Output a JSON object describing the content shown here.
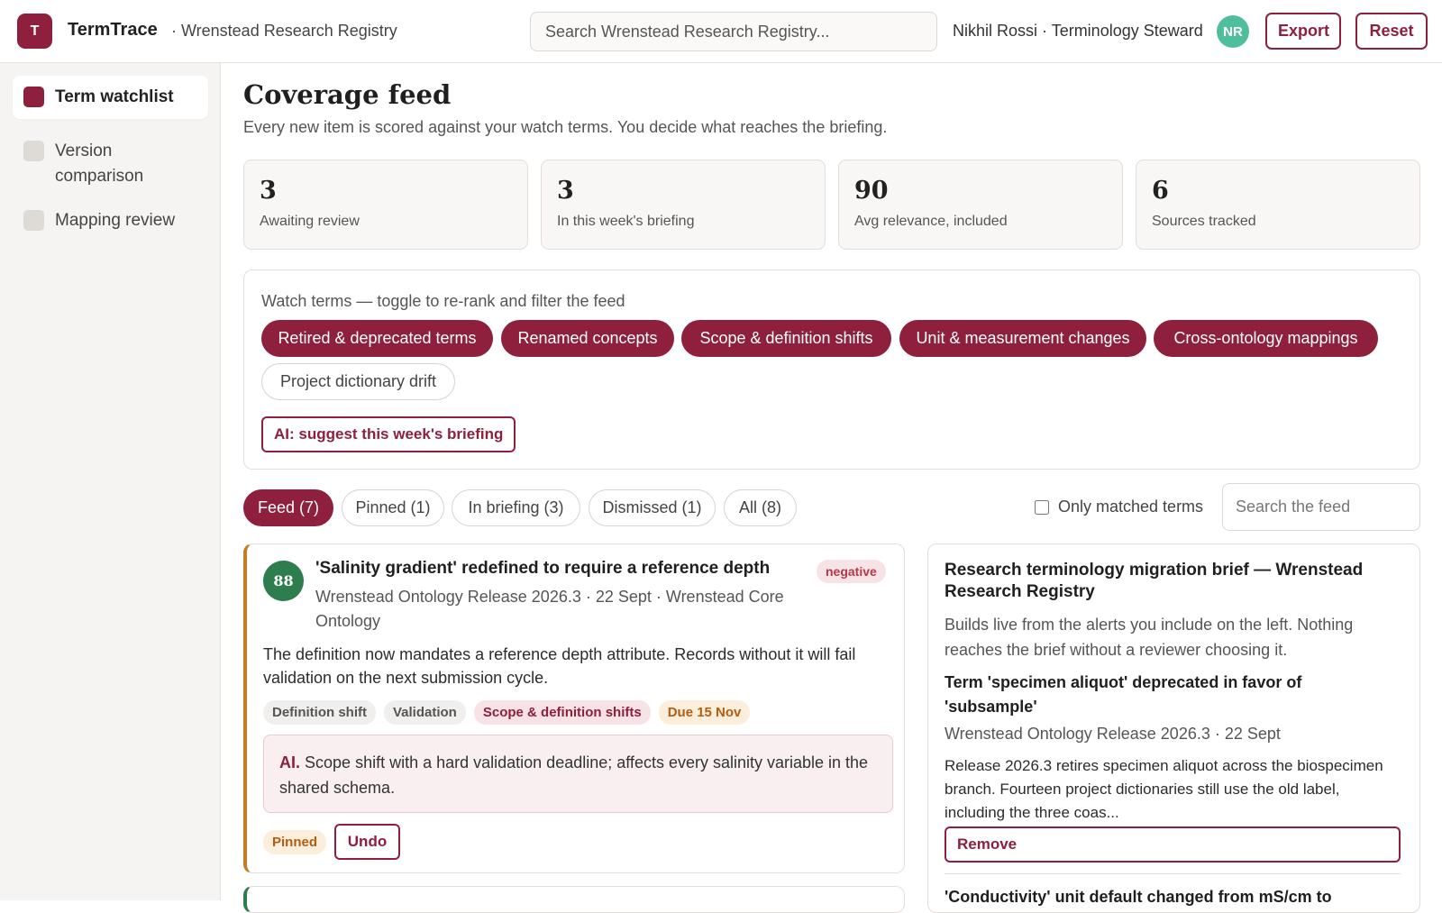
{
  "header": {
    "logo_letter": "T",
    "app_name": "TermTrace",
    "app_sub": "· Wrenstead Research Registry",
    "search_placeholder": "Search Wrenstead Research Registry...",
    "user": "Nikhil Rossi · Terminology Steward",
    "avatar_initials": "NR",
    "export_label": "Export",
    "reset_label": "Reset"
  },
  "sidebar": {
    "items": [
      {
        "label": "Term watchlist",
        "active": true
      },
      {
        "label": "Version comparison",
        "active": false
      },
      {
        "label": "Mapping review",
        "active": false
      }
    ]
  },
  "main": {
    "title": "Coverage feed",
    "description": "Every new item is scored against your watch terms. You decide what reaches the briefing.",
    "stats": [
      {
        "value": "3",
        "label": "Awaiting review"
      },
      {
        "value": "3",
        "label": "In this week's briefing"
      },
      {
        "value": "90",
        "label": "Avg relevance, included"
      },
      {
        "value": "6",
        "label": "Sources tracked"
      }
    ],
    "watch": {
      "title": "Watch terms — toggle to re-rank and filter the feed",
      "chips": [
        {
          "label": "Retired & deprecated terms",
          "on": true
        },
        {
          "label": "Renamed concepts",
          "on": true
        },
        {
          "label": "Scope & definition shifts",
          "on": true
        },
        {
          "label": "Unit & measurement changes",
          "on": true
        },
        {
          "label": "Cross-ontology mappings",
          "on": true
        },
        {
          "label": "Project dictionary drift",
          "on": false
        }
      ],
      "ai_suggest_label": "AI: suggest this week's briefing"
    },
    "tabs": [
      {
        "label": "Feed (7)",
        "active": true
      },
      {
        "label": "Pinned (1)",
        "active": false
      },
      {
        "label": "In briefing (3)",
        "active": false
      },
      {
        "label": "Dismissed (1)",
        "active": false
      },
      {
        "label": "All (8)",
        "active": false
      }
    ],
    "only_matched_label": "Only matched terms",
    "feed_search_placeholder": "Search the feed"
  },
  "feed_card": {
    "score": "88",
    "title": "'Salinity gradient' redefined to require a reference depth",
    "sentiment": "negative",
    "meta": "Wrenstead Ontology Release 2026.3 · 22 Sept · Wrenstead Core Ontology",
    "body": "The definition now mandates a reference depth attribute. Records without it will fail validation on the next submission cycle.",
    "tags": [
      {
        "label": "Definition shift",
        "kind": "neutral"
      },
      {
        "label": "Validation",
        "kind": "neutral"
      },
      {
        "label": "Scope & definition shifts",
        "kind": "matched"
      },
      {
        "label": "Due 15 Nov",
        "kind": "due"
      }
    ],
    "ai_prefix": "AI.",
    "ai_note": "Scope shift with a hard validation deadline; affects every salinity variable in the shared schema.",
    "pinned_label": "Pinned",
    "undo_label": "Undo"
  },
  "brief": {
    "title": "Research terminology migration brief — Wrenstead Research Registry",
    "description": "Builds live from the alerts you include on the left. Nothing reaches the brief without a reviewer choosing it.",
    "item_title": "Term 'specimen aliquot' deprecated in favor of 'subsample'",
    "item_meta": "Wrenstead Ontology Release 2026.3 · 22 Sept",
    "item_body": "Release 2026.3 retires specimen aliquot across the biospecimen branch. Fourteen project dictionaries still use the old label, including the three coas...",
    "remove_label": "Remove",
    "next_title": "'Conductivity' unit default changed from mS/cm to"
  },
  "colors": {
    "accent": "#8e1f3d",
    "score_green": "#2e7d4f",
    "avatar": "#4fbf9b",
    "card_left_border": "#c57b2a"
  },
  "icons": {
    "sidebar_marker": "square-marker-icon"
  }
}
